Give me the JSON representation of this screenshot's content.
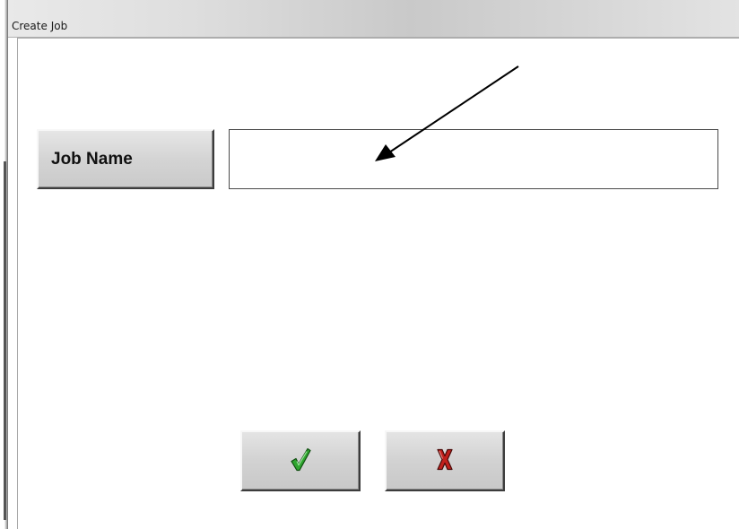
{
  "window": {
    "title": "Create Job"
  },
  "form": {
    "job_name_label": "Job Name",
    "job_name_value": "",
    "job_name_placeholder": ""
  },
  "buttons": {
    "ok_icon": "green-checkmark-icon",
    "cancel_icon": "red-x-icon"
  },
  "colors": {
    "ok_icon": "#2fa52f",
    "cancel_icon": "#c0201c"
  }
}
